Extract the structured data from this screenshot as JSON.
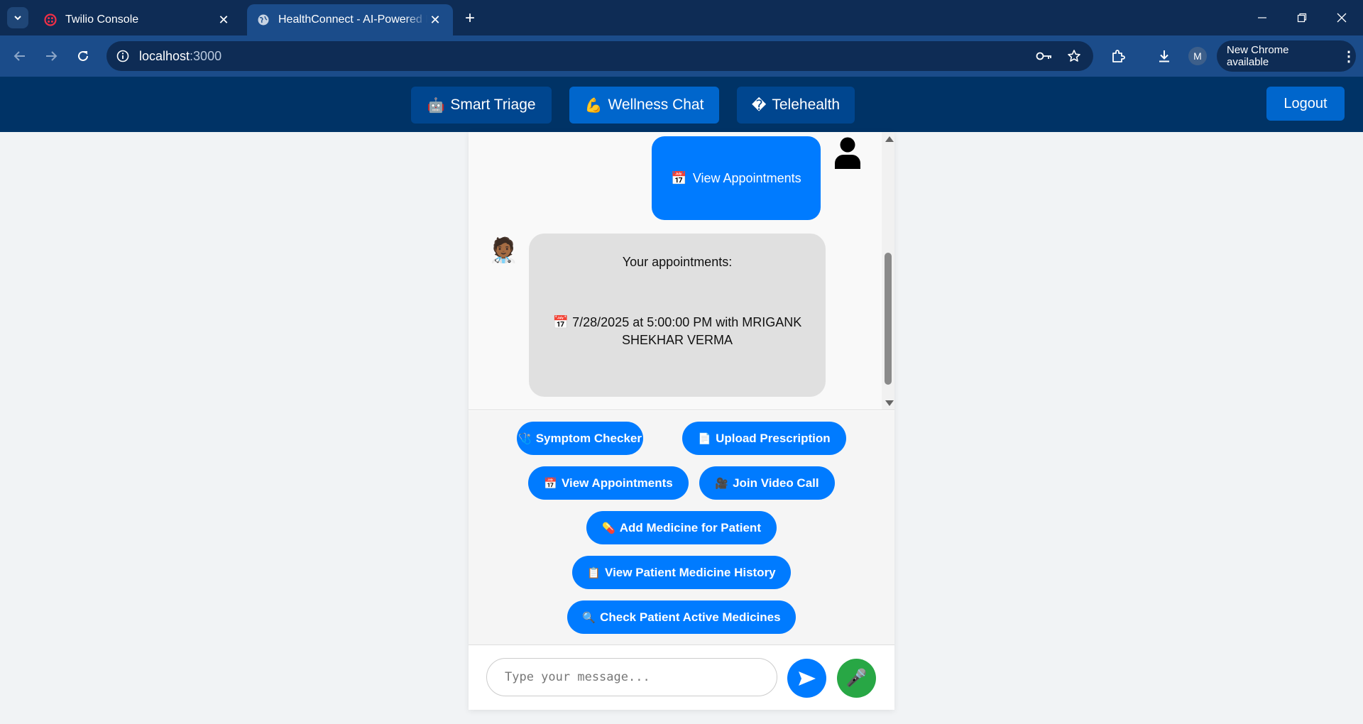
{
  "browser": {
    "tabs": [
      {
        "title": "Twilio Console",
        "active": false
      },
      {
        "title": "HealthConnect - AI-Powered Medical Assistant",
        "active": true
      }
    ],
    "url_host": "localhost",
    "url_port": ":3000",
    "profile_initial": "M",
    "update_label": "New Chrome available"
  },
  "header": {
    "nav": [
      {
        "label": "Smart Triage",
        "icon": "🤖"
      },
      {
        "label": "Wellness Chat",
        "icon": "💪"
      },
      {
        "label": "Telehealth",
        "icon": "�"
      }
    ],
    "logout_label": "Logout"
  },
  "chat": {
    "user_message": {
      "icon": "📅",
      "text": "View Appointments"
    },
    "bot_avatar": "🧑🏾‍⚕️",
    "bot_message": {
      "line1": "Your appointments:",
      "line2_icon": "📅",
      "line2": "7/28/2025 at 5:00:00 PM with MRIGANK SHEKHAR VERMA"
    }
  },
  "quick_actions": [
    {
      "icon": "🩺",
      "label": "Symptom Checker"
    },
    {
      "icon": "📄",
      "label": "Upload Prescription"
    },
    {
      "icon": "📅",
      "label": "View Appointments"
    },
    {
      "icon": "🎥",
      "label": "Join Video Call"
    },
    {
      "icon": "💊",
      "label": "Add Medicine for Patient"
    },
    {
      "icon": "📋",
      "label": "View Patient Medicine History"
    },
    {
      "icon": "🔍",
      "label": "Check Patient Active Medicines"
    }
  ],
  "input": {
    "placeholder": "Type your message...",
    "value": "",
    "mic_icon": "🎤"
  },
  "colors": {
    "header_bg": "#003366",
    "nav_active": "#0066cc",
    "primary": "#007bff",
    "mic": "#28a745"
  }
}
